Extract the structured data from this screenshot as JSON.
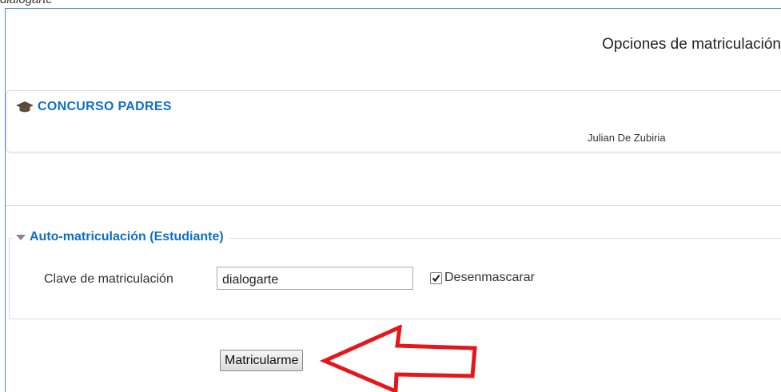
{
  "caption": "dialogarte",
  "header": {
    "title": "Opciones de matriculación"
  },
  "course": {
    "name": "CONCURSO PADRES",
    "icon": "graduation-cap-icon",
    "teacher": "Julian De Zubiria"
  },
  "enrol_method": {
    "legend": "Auto-matriculación (Estudiante)",
    "key_label": "Clave de matriculación",
    "key_value": "dialogarte",
    "unmask_label": "Desenmascarar",
    "unmask_checked": true,
    "submit_label": "Matricularme"
  },
  "colors": {
    "link": "#0f6fc6",
    "annotation": "#e8161b",
    "frame": "#4a89dc"
  }
}
